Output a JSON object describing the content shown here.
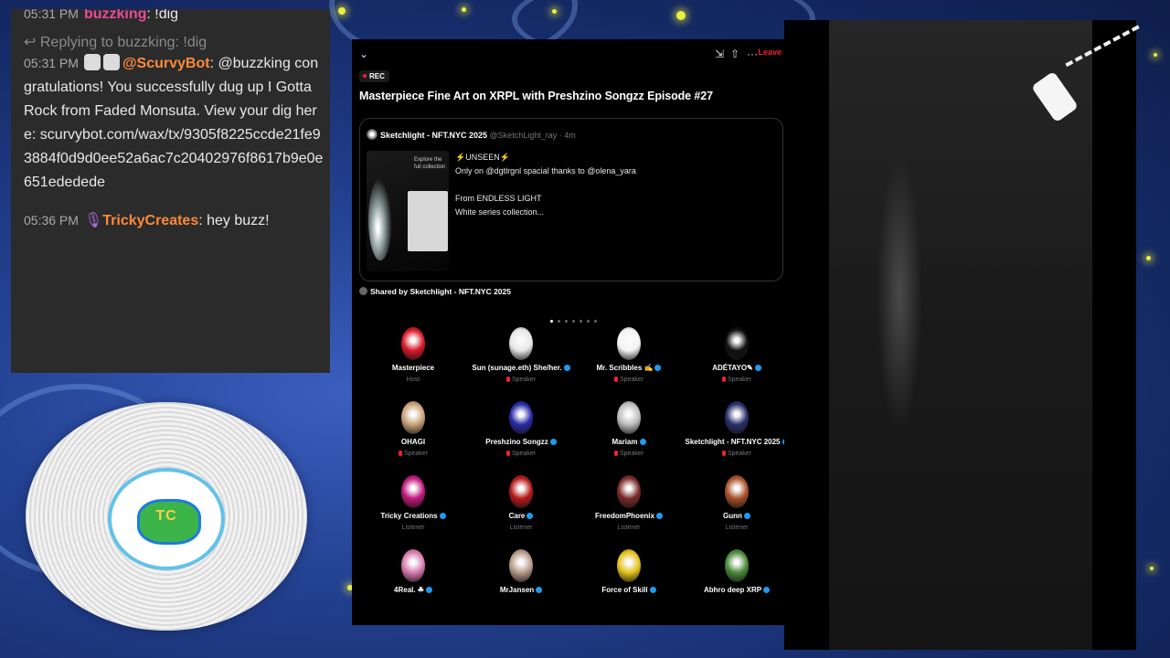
{
  "chat": {
    "top_partial": {
      "time": "05:31 PM",
      "user": "buzzking",
      "text": ": !dig"
    },
    "reply_note": "Replying to buzzking: !dig",
    "message1": {
      "time": "05:31 PM",
      "user": "@ScurvyBot",
      "sep": ":",
      "text": " @buzzking congratulations! You successfully dug up I Gotta Rock from Faded Monsuta. View your dig here: scurvybot.com/wax/tx/9305f8225ccde21fe93884f0d9d0ee52a6ac7c20402976f8617b9e0e651ededede"
    },
    "message2": {
      "time": "05:36 PM",
      "user": "TrickyCreates",
      "sep": ":",
      "text": " hey buzz!"
    }
  },
  "space": {
    "rec_label": "REC",
    "leave_label": "Leave",
    "title": "Masterpiece Fine Art on XRPL with Preshzino Songzz  Episode #27",
    "card": {
      "author": "Sketchlight - NFT.NYC 2025",
      "handle": "@SketchLight_ray · 4m",
      "image_text": "Explore the full collection",
      "line1": "⚡UNSEEN⚡",
      "line2": "Only on @dgtlrgnl spacial thanks to @olena_yara",
      "line3": "From ENDLESS LIGHT",
      "line4": "White series collection..."
    },
    "shared_by": "Shared by Sketchlight - NFT.NYC 2025",
    "people": [
      {
        "name": "Masterpiece",
        "role": "Host",
        "color": "#d8192a"
      },
      {
        "name": "Sun (sunage.eth) She/her.",
        "role": "Speaker",
        "color": "#e8e8e8"
      },
      {
        "name": "Mr. Scribbles ✍",
        "role": "Speaker",
        "color": "#f4f4f4"
      },
      {
        "name": "ADÉTAYO✎",
        "role": "Speaker",
        "color": "#111111"
      },
      {
        "name": "OHAGI",
        "role": "Speaker",
        "color": "#c9a27a"
      },
      {
        "name": "Preshzino Songzz",
        "role": "Speaker",
        "color": "#2a2aa8"
      },
      {
        "name": "Mariam",
        "role": "Speaker",
        "color": "#bdbdbd"
      },
      {
        "name": "Sketchlight - NFT.NYC 2025",
        "role": "Speaker",
        "color": "#2a2f6a"
      },
      {
        "name": "Tricky Creations",
        "role": "Listener",
        "color": "#c2187e"
      },
      {
        "name": "Care",
        "role": "Listener",
        "color": "#b51a1a"
      },
      {
        "name": "FreedomPhoenix",
        "role": "Listener",
        "color": "#7a2a2a"
      },
      {
        "name": "Gunn",
        "role": "Listener",
        "color": "#a8512a"
      },
      {
        "name": "4Real. ☘",
        "role": "",
        "color": "#d87ab0"
      },
      {
        "name": "MrJansen",
        "role": "",
        "color": "#b89c8a"
      },
      {
        "name": "Force of Skill",
        "role": "",
        "color": "#e3c21a"
      },
      {
        "name": "Abhro deep XRP",
        "role": "",
        "color": "#4a8a3a"
      }
    ]
  },
  "vinyl": {
    "label_text": "TC"
  },
  "colors": {
    "accent_red": "#f4212e",
    "verified": "#1d9bf0",
    "chat_bg": "#2b2b2b"
  }
}
